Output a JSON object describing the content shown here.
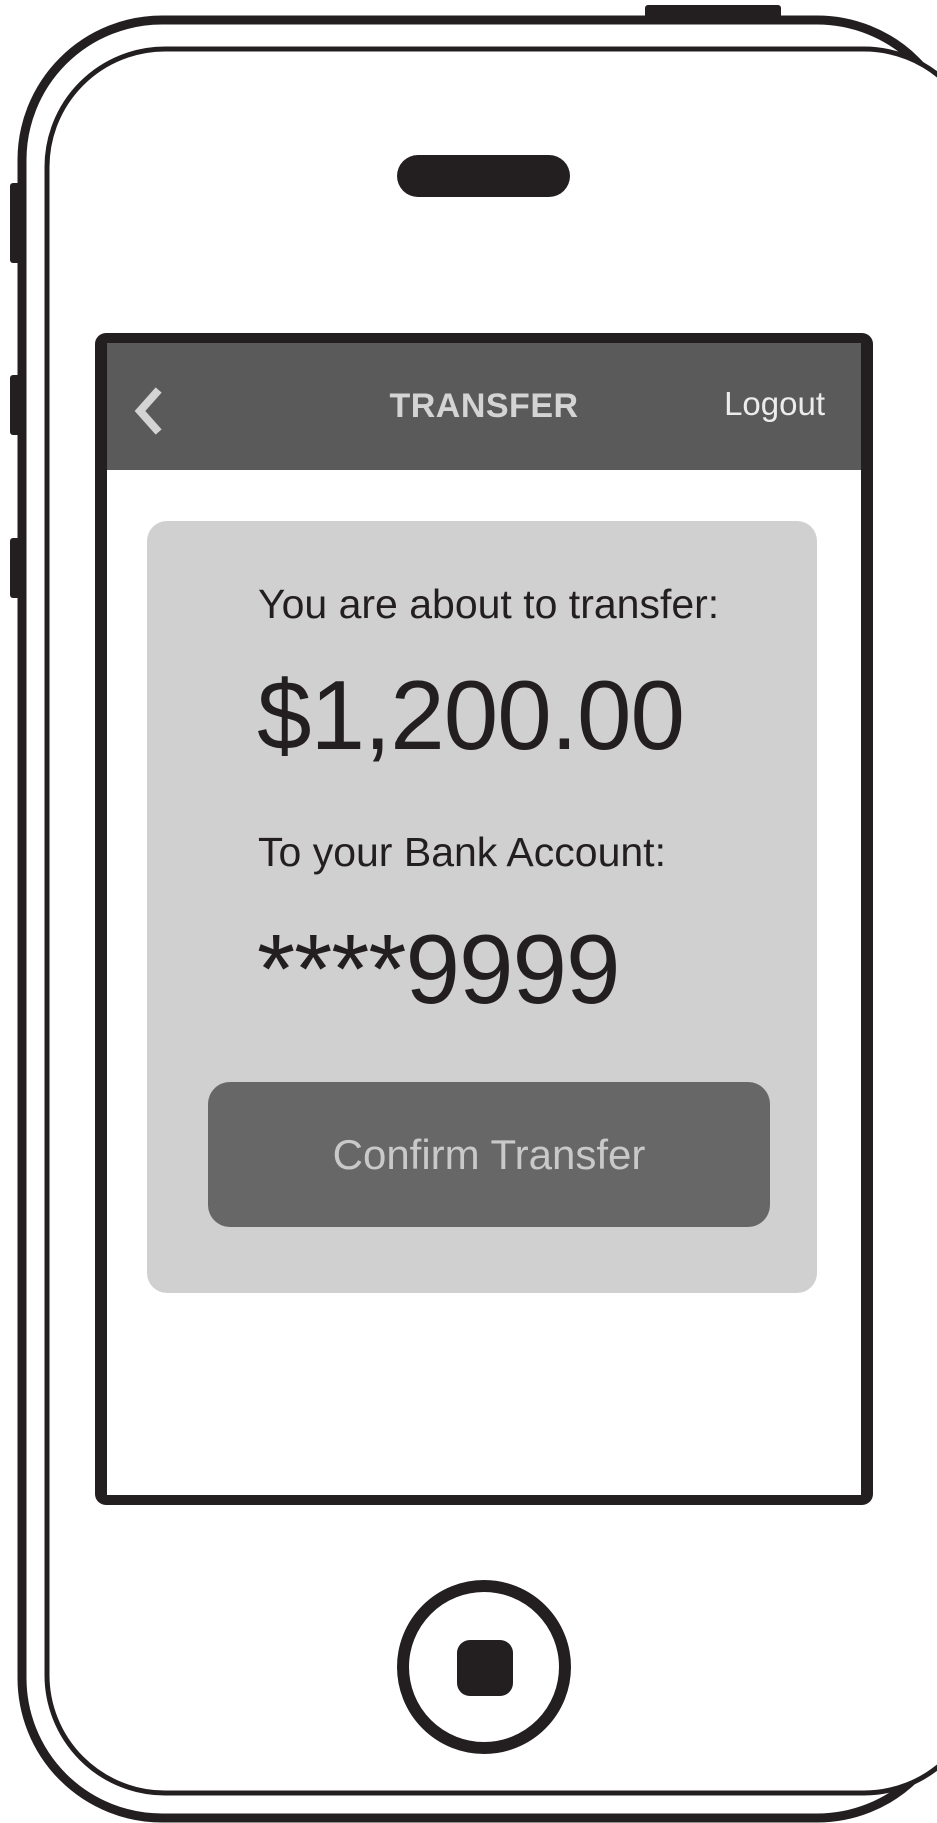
{
  "header": {
    "back_icon": "chevron-left-icon",
    "title": "TRANSFER",
    "logout_label": "Logout"
  },
  "confirmation": {
    "amount_label": "You are about to transfer:",
    "amount": "$1,200.00",
    "account_label": "To your Bank Account:",
    "account": "****9999",
    "confirm_label": "Confirm Transfer"
  },
  "colors": {
    "nav_bar": "#5a5a5a",
    "card": "#d0d0d0",
    "button": "#676767",
    "text": "#231f20",
    "device_outline": "#231f20"
  }
}
